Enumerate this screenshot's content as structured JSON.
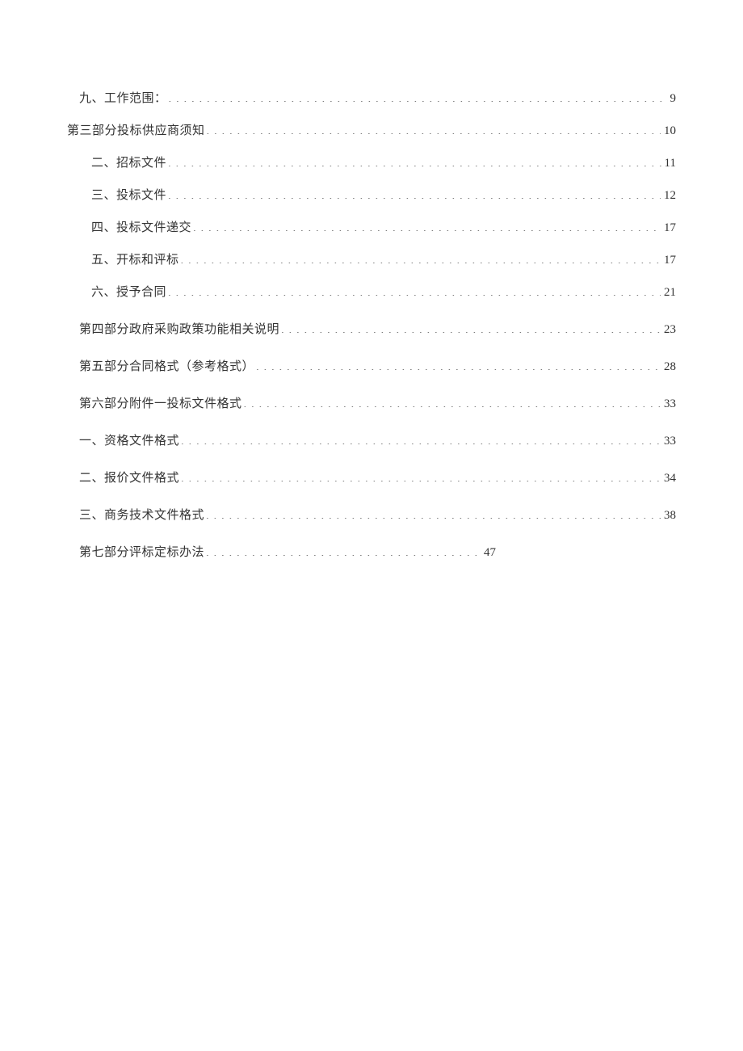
{
  "toc": {
    "entries": [
      {
        "label": "九、工作范围：",
        "page": "9",
        "indent": 1,
        "style": "section-first"
      },
      {
        "label": "第三部分投标供应商须知",
        "page": "10",
        "indent": 0,
        "style": "section-first"
      },
      {
        "label": "二、招标文件",
        "page": "11",
        "indent": 2,
        "style": ""
      },
      {
        "label": "三、投标文件",
        "page": "12",
        "indent": 2,
        "style": ""
      },
      {
        "label": "四、投标文件递交",
        "page": "17",
        "indent": 2,
        "style": ""
      },
      {
        "label": "五、开标和评标",
        "page": "17",
        "indent": 2,
        "style": ""
      },
      {
        "label": "六、授予合同",
        "page": "21",
        "indent": 2,
        "style": "section"
      },
      {
        "label": "第四部分政府采购政策功能相关说明",
        "page": "23",
        "indent": 1,
        "style": "section"
      },
      {
        "label": "第五部分合同格式（参考格式）",
        "page": "28",
        "indent": 1,
        "style": "section"
      },
      {
        "label": "第六部分附件一投标文件格式",
        "page": "33",
        "indent": 1,
        "style": "section"
      },
      {
        "label": "一、资格文件格式",
        "page": "33",
        "indent": 1,
        "style": "section"
      },
      {
        "label": "二、报价文件格式",
        "page": "34",
        "indent": 1,
        "style": "section"
      },
      {
        "label": "三、商务技术文件格式",
        "page": "38",
        "indent": 1,
        "style": "section"
      },
      {
        "label": "第七部分评标定标办法",
        "page": "47",
        "indent": 1,
        "style": "short"
      }
    ]
  }
}
